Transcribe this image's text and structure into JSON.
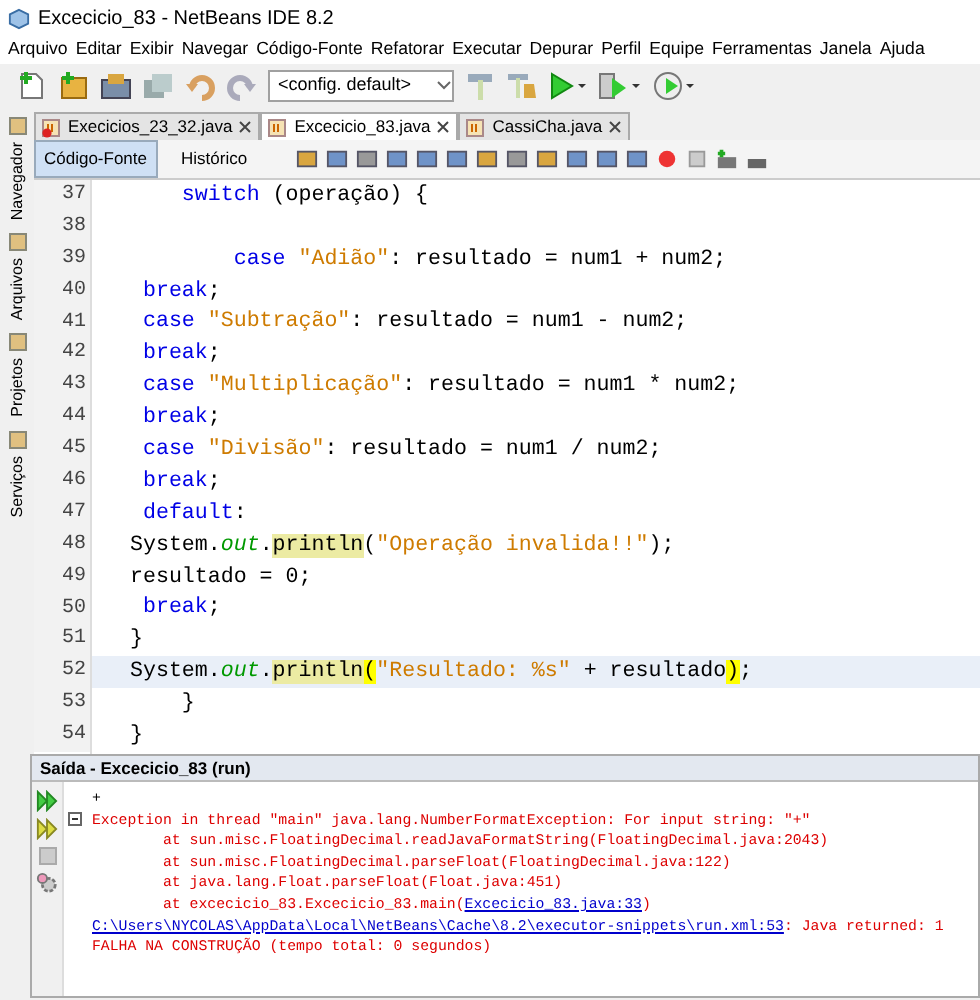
{
  "window": {
    "title": "Excecicio_83 - NetBeans IDE 8.2"
  },
  "menu": [
    "Arquivo",
    "Editar",
    "Exibir",
    "Navegar",
    "Código-Fonte",
    "Refatorar",
    "Executar",
    "Depurar",
    "Perfil",
    "Equipe",
    "Ferramentas",
    "Janela",
    "Ajuda"
  ],
  "toolbar": {
    "config": "<config. default>"
  },
  "side_panels": [
    "Navegador",
    "Arquivos",
    "Projetos",
    "Serviços"
  ],
  "tabs": [
    {
      "label": "Execicios_23_32.java",
      "selected": false,
      "error": true
    },
    {
      "label": "Excecicio_83.java",
      "selected": true,
      "error": false
    },
    {
      "label": "CassiCha.java",
      "selected": false,
      "error": false
    }
  ],
  "editor": {
    "views": [
      {
        "label": "Código-Fonte",
        "selected": true
      },
      {
        "label": "Histórico",
        "selected": false
      }
    ],
    "lines": [
      {
        "number": "37",
        "current": false,
        "segments": [
          {
            "text": "    switch",
            "kind": "keyword"
          },
          {
            "text": " (operação) {",
            "kind": "plain"
          }
        ]
      },
      {
        "number": "38",
        "current": false
      },
      {
        "number": "39",
        "current": false,
        "segments": [
          {
            "text": "        case ",
            "kind": "keyword"
          },
          {
            "text": "\"Adião\"",
            "kind": "string"
          },
          {
            "text": ": resultado = num1 + num2;",
            "kind": "plain"
          }
        ]
      },
      {
        "number": "40",
        "current": false,
        "segments": [
          {
            "text": " break",
            "kind": "keyword"
          },
          {
            "text": ";",
            "kind": "plain"
          }
        ]
      },
      {
        "number": "41",
        "current": false,
        "segments": [
          {
            "text": " case ",
            "kind": "keyword"
          },
          {
            "text": "\"Subtração\"",
            "kind": "string"
          },
          {
            "text": ": resultado = num1 - num2;",
            "kind": "plain"
          }
        ]
      },
      {
        "number": "42",
        "current": false,
        "segments": [
          {
            "text": " break",
            "kind": "keyword"
          },
          {
            "text": ";",
            "kind": "plain"
          }
        ]
      },
      {
        "number": "43",
        "current": false,
        "segments": [
          {
            "text": " case ",
            "kind": "keyword"
          },
          {
            "text": "\"Multiplicação\"",
            "kind": "string"
          },
          {
            "text": ": resultado = num1 * num2;",
            "kind": "plain"
          }
        ]
      },
      {
        "number": "44",
        "current": false,
        "segments": [
          {
            "text": " break",
            "kind": "keyword"
          },
          {
            "text": ";",
            "kind": "plain"
          }
        ]
      },
      {
        "number": "45",
        "current": false,
        "segments": [
          {
            "text": " case ",
            "kind": "keyword"
          },
          {
            "text": "\"Divisão\"",
            "kind": "string"
          },
          {
            "text": ": resultado = num1 / num2;",
            "kind": "plain"
          }
        ]
      },
      {
        "number": "46",
        "current": false,
        "segments": [
          {
            "text": " break",
            "kind": "keyword"
          },
          {
            "text": ";",
            "kind": "plain"
          }
        ]
      },
      {
        "number": "47",
        "current": false,
        "segments": [
          {
            "text": " default",
            "kind": "keyword"
          },
          {
            "text": ":",
            "kind": "plain"
          }
        ]
      },
      {
        "number": "48",
        "current": false,
        "segments": [
          {
            "text": "System.",
            "kind": "plain"
          },
          {
            "text": "out",
            "kind": "field"
          },
          {
            "text": ".",
            "kind": "plain"
          },
          {
            "text": "println",
            "kind": "occurrence"
          },
          {
            "text": "(",
            "kind": "plain"
          },
          {
            "text": "\"Operação invalida!!\"",
            "kind": "string"
          },
          {
            "text": ");",
            "kind": "plain"
          }
        ]
      },
      {
        "number": "49",
        "current": false,
        "segments": [
          {
            "text": "resultado = 0;",
            "kind": "plain"
          }
        ]
      },
      {
        "number": "50",
        "current": false,
        "segments": [
          {
            "text": " break",
            "kind": "keyword"
          },
          {
            "text": ";",
            "kind": "plain"
          }
        ]
      },
      {
        "number": "51",
        "current": false,
        "segments": [
          {
            "text": "}",
            "kind": "plain"
          }
        ]
      },
      {
        "number": "52",
        "current": true,
        "segments": [
          {
            "text": "System.",
            "kind": "plain"
          },
          {
            "text": "out",
            "kind": "field"
          },
          {
            "text": ".",
            "kind": "plain"
          },
          {
            "text": "println",
            "kind": "occurrence"
          },
          {
            "text": "(",
            "kind": "match"
          },
          {
            "text": "\"Resultado: %s\"",
            "kind": "string"
          },
          {
            "text": " + resultado",
            "kind": "plain"
          },
          {
            "text": ")",
            "kind": "match"
          },
          {
            "text": ";",
            "kind": "plain"
          }
        ]
      },
      {
        "number": "53",
        "current": false,
        "segments": [
          {
            "text": "    }",
            "kind": "plain"
          }
        ]
      },
      {
        "number": "54",
        "current": false,
        "segments": [
          {
            "text": "}",
            "kind": "plain"
          }
        ]
      }
    ]
  },
  "output": {
    "title": "Saída - Excecicio_83 (run)",
    "lines": [
      {
        "segments": [
          {
            "text": "+",
            "kind": "plain"
          }
        ]
      },
      {
        "segments": [
          {
            "text": "Exception in thread \"main\" java.lang.NumberFormatException: For input string: \"+\"",
            "kind": "error"
          }
        ]
      },
      {
        "segments": [
          {
            "text": "        at sun.misc.FloatingDecimal.readJavaFormatString(FloatingDecimal.java:2043)",
            "kind": "error"
          }
        ]
      },
      {
        "segments": [
          {
            "text": "        at sun.misc.FloatingDecimal.parseFloat(FloatingDecimal.java:122)",
            "kind": "error"
          }
        ]
      },
      {
        "segments": [
          {
            "text": "        at java.lang.Float.parseFloat(Float.java:451)",
            "kind": "error"
          }
        ]
      },
      {
        "segments": [
          {
            "text": "        at excecicio_83.Excecicio_83.main(",
            "kind": "error"
          },
          {
            "text": "Excecicio_83.java:33",
            "kind": "link"
          },
          {
            "text": ")",
            "kind": "error"
          }
        ]
      },
      {
        "segments": [
          {
            "text": "C:\\Users\\NYCOLAS\\AppData\\Local\\NetBeans\\Cache\\8.2\\executor-snippets\\run.xml:53",
            "kind": "link"
          },
          {
            "text": ": Java returned: 1",
            "kind": "error"
          }
        ]
      },
      {
        "segments": [
          {
            "text": "FALHA NA CONSTRUÇÃO (tempo total: 0 segundos)",
            "kind": "error"
          }
        ]
      }
    ]
  }
}
